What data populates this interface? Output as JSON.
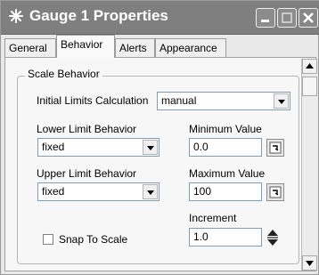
{
  "window": {
    "title": "Gauge 1 Properties"
  },
  "tabs": [
    {
      "label": "General"
    },
    {
      "label": "Behavior"
    },
    {
      "label": "Alerts"
    },
    {
      "label": "Appearance"
    }
  ],
  "scale_behavior": {
    "group_label": "Scale Behavior",
    "initial_limits": {
      "label": "Initial Limits Calculation",
      "value": "manual"
    },
    "lower_limit_behavior": {
      "label": "Lower Limit Behavior",
      "value": "fixed"
    },
    "upper_limit_behavior": {
      "label": "Upper Limit Behavior",
      "value": "fixed"
    },
    "minimum_value": {
      "label": "Minimum Value",
      "value": "0.0"
    },
    "maximum_value": {
      "label": "Maximum Value",
      "value": "100"
    },
    "increment": {
      "label": "Increment",
      "value": "1.0"
    },
    "snap_to_scale": {
      "label": "Snap To Scale",
      "checked": false
    }
  },
  "icons": {
    "window": "asterisk-icon",
    "minimize": "minimize-icon",
    "maximize": "maximize-icon",
    "close": "close-icon"
  }
}
